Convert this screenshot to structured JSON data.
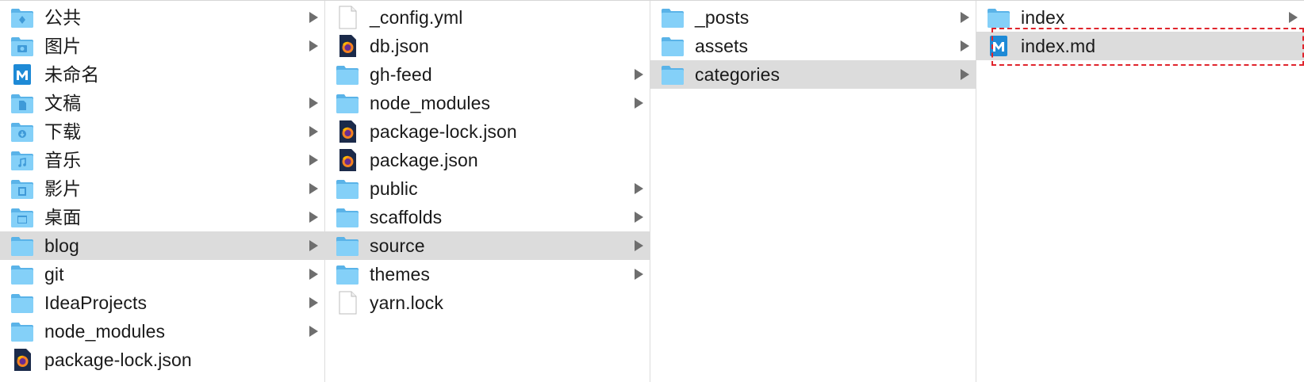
{
  "columns": [
    {
      "items": [
        {
          "label": "公共",
          "icon": "public-folder-icon",
          "arrow": true,
          "selected": false
        },
        {
          "label": "图片",
          "icon": "pictures-folder-icon",
          "arrow": true,
          "selected": false
        },
        {
          "label": "未命名",
          "icon": "markdown-file-icon",
          "arrow": false,
          "selected": false
        },
        {
          "label": "文稿",
          "icon": "documents-folder-icon",
          "arrow": true,
          "selected": false
        },
        {
          "label": "下载",
          "icon": "downloads-folder-icon",
          "arrow": true,
          "selected": false
        },
        {
          "label": "音乐",
          "icon": "music-folder-icon",
          "arrow": true,
          "selected": false
        },
        {
          "label": "影片",
          "icon": "movies-folder-icon",
          "arrow": true,
          "selected": false
        },
        {
          "label": "桌面",
          "icon": "desktop-folder-icon",
          "arrow": true,
          "selected": false
        },
        {
          "label": "blog",
          "icon": "folder-icon",
          "arrow": true,
          "selected": true
        },
        {
          "label": "git",
          "icon": "folder-icon",
          "arrow": true,
          "selected": false
        },
        {
          "label": "IdeaProjects",
          "icon": "folder-icon",
          "arrow": true,
          "selected": false
        },
        {
          "label": "node_modules",
          "icon": "folder-icon",
          "arrow": true,
          "selected": false
        },
        {
          "label": "package-lock.json",
          "icon": "firefox-file-icon",
          "arrow": false,
          "selected": false
        }
      ]
    },
    {
      "items": [
        {
          "label": "_config.yml",
          "icon": "blank-file-icon",
          "arrow": false,
          "selected": false
        },
        {
          "label": "db.json",
          "icon": "firefox-file-icon",
          "arrow": false,
          "selected": false
        },
        {
          "label": "gh-feed",
          "icon": "folder-icon",
          "arrow": true,
          "selected": false
        },
        {
          "label": "node_modules",
          "icon": "folder-icon",
          "arrow": true,
          "selected": false
        },
        {
          "label": "package-lock.json",
          "icon": "firefox-file-icon",
          "arrow": false,
          "selected": false
        },
        {
          "label": "package.json",
          "icon": "firefox-file-icon",
          "arrow": false,
          "selected": false
        },
        {
          "label": "public",
          "icon": "folder-icon",
          "arrow": true,
          "selected": false
        },
        {
          "label": "scaffolds",
          "icon": "folder-icon",
          "arrow": true,
          "selected": false
        },
        {
          "label": "source",
          "icon": "folder-icon",
          "arrow": true,
          "selected": true
        },
        {
          "label": "themes",
          "icon": "folder-icon",
          "arrow": true,
          "selected": false
        },
        {
          "label": "yarn.lock",
          "icon": "blank-file-icon",
          "arrow": false,
          "selected": false
        }
      ]
    },
    {
      "items": [
        {
          "label": "_posts",
          "icon": "folder-icon",
          "arrow": true,
          "selected": false
        },
        {
          "label": "assets",
          "icon": "folder-icon",
          "arrow": true,
          "selected": false
        },
        {
          "label": "categories",
          "icon": "folder-icon",
          "arrow": true,
          "selected": true
        }
      ]
    },
    {
      "items": [
        {
          "label": "index",
          "icon": "folder-icon",
          "arrow": true,
          "selected": false
        },
        {
          "label": "index.md",
          "icon": "markdown-file-icon",
          "arrow": false,
          "selected": true
        }
      ]
    }
  ],
  "colors": {
    "folder": "#72c6f5",
    "folder_dark": "#5ab3e8",
    "selection": "#dcdcdc",
    "arrow": "#6e6e6e",
    "highlight_dash": "#e0242c",
    "markdown_blue": "#1e8ad6"
  }
}
